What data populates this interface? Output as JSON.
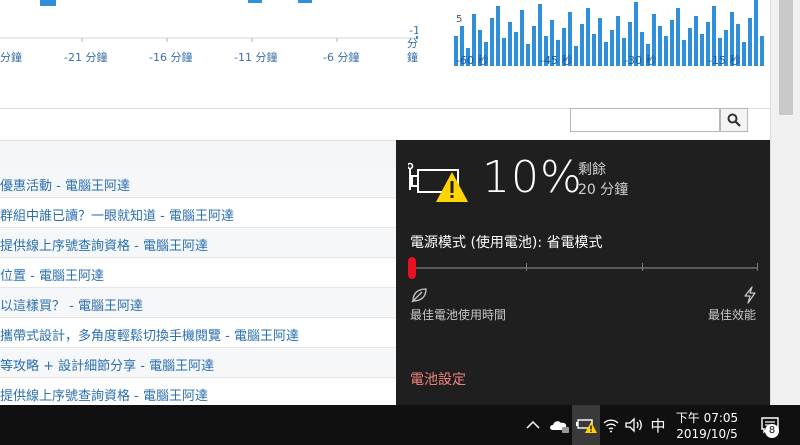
{
  "charts": {
    "minutes": {
      "tick_labels": [
        "分鐘",
        "-21 分鐘",
        "-16 分鐘",
        "-11 分鐘",
        "-6 分鐘",
        "-1",
        "分",
        "鐘"
      ]
    },
    "seconds": {
      "y_label": "5",
      "tick_labels": [
        "-60 秒",
        "-45 秒",
        "-30 秒",
        "-15 秒"
      ]
    }
  },
  "search": {
    "value": "",
    "placeholder": ""
  },
  "list": {
    "rows": [
      "優惠活動 - 電腦王阿達",
      "群組中誰已讀？一眼就知道 - 電腦王阿達",
      "提供線上序號查詢資格 - 電腦王阿達",
      "位置 - 電腦王阿達",
      "以這樣買？ - 電腦王阿達",
      "攜帶式設計，多角度輕鬆切換手機閱覽 - 電腦王阿達",
      "等攻略 + 設計細節分享 - 電腦王阿達",
      "提供線上序號查詢資格 - 電腦王阿達"
    ]
  },
  "battery": {
    "percent": "10%",
    "remaining_label": "剩餘",
    "remaining_time": "20 分鐘",
    "power_mode_label": "電源模式 (使用電池): 省電模式",
    "slider_position": 0,
    "best_battery_label": "最佳電池使用時間",
    "best_performance_label": "最佳效能",
    "settings_link": "電池設定",
    "warning_color": "#ffd400",
    "slider_color": "#e81123"
  },
  "taskbar": {
    "ime": "中",
    "time": "下午 07:05",
    "date": "2019/10/5",
    "notification_count": "8",
    "tray_icons": [
      "chevron-up-icon",
      "onedrive-icon",
      "battery-warning-icon",
      "wifi-icon",
      "volume-icon"
    ]
  },
  "chart_data": [
    {
      "type": "bar",
      "title": "",
      "categories": [
        "-60 秒",
        "-45 秒",
        "-30 秒",
        "-15 秒"
      ],
      "ylabel": "5"
    }
  ]
}
